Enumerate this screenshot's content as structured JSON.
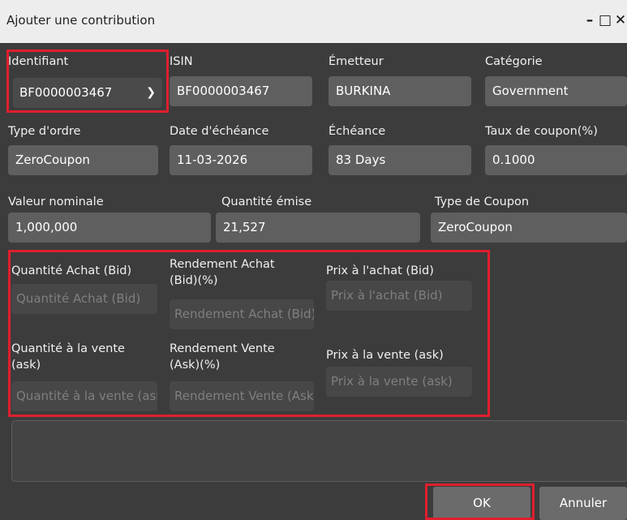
{
  "window": {
    "title": "Ajouter une contribution",
    "min_glyph": "–",
    "max_glyph": "□",
    "close_glyph": "✕"
  },
  "row1": {
    "identifiant_label": "Identifiant",
    "identifiant_value": "BF0000003467",
    "isin_label": "ISIN",
    "isin_value": "BF0000003467",
    "emetteur_label": "Émetteur",
    "emetteur_value": "BURKINA",
    "categorie_label": "Catégorie",
    "categorie_value": "Government"
  },
  "row2": {
    "type_ordre_label": "Type d'ordre",
    "type_ordre_value": "ZeroCoupon",
    "date_echeance_label": "Date d'échéance",
    "date_echeance_value": "11-03-2026",
    "echeance_label": "Échéance",
    "echeance_value": "83 Days",
    "taux_label": "Taux de coupon(%)",
    "taux_value": "0.1000"
  },
  "row3": {
    "valeur_label": "Valeur nominale",
    "valeur_value": "1,000,000",
    "quantite_emise_label": "Quantité émise",
    "quantite_emise_value": "21,527",
    "type_coupon_label": "Type de Coupon",
    "type_coupon_value": "ZeroCoupon"
  },
  "bid_ask": {
    "qty_bid_label": "Quantité Achat (Bid)",
    "qty_bid_placeholder": "Quantité Achat (Bid)",
    "yield_bid_label_1": "Rendement Achat",
    "yield_bid_label_2": "(Bid)(%)",
    "yield_bid_placeholder": "Rendement Achat (Bid)(%)",
    "price_bid_label": "Prix à l'achat (Bid)",
    "price_bid_placeholder": "Prix à l'achat (Bid)",
    "qty_ask_label_1": "Quantité à la vente",
    "qty_ask_label_2": "(ask)",
    "qty_ask_placeholder": "Quantité à la vente (ask)",
    "yield_ask_label_1": "Rendement Vente",
    "yield_ask_label_2": "(Ask)(%)",
    "yield_ask_placeholder": "Rendement Vente (Ask)(%)",
    "price_ask_label": "Prix à la vente (ask)",
    "price_ask_placeholder": "Prix à la vente (ask)"
  },
  "buttons": {
    "ok": "OK",
    "cancel": "Annuler"
  },
  "colors": {
    "highlight": "#e01e2e",
    "background": "#3c3c3c",
    "field": "#5f5f5f"
  }
}
